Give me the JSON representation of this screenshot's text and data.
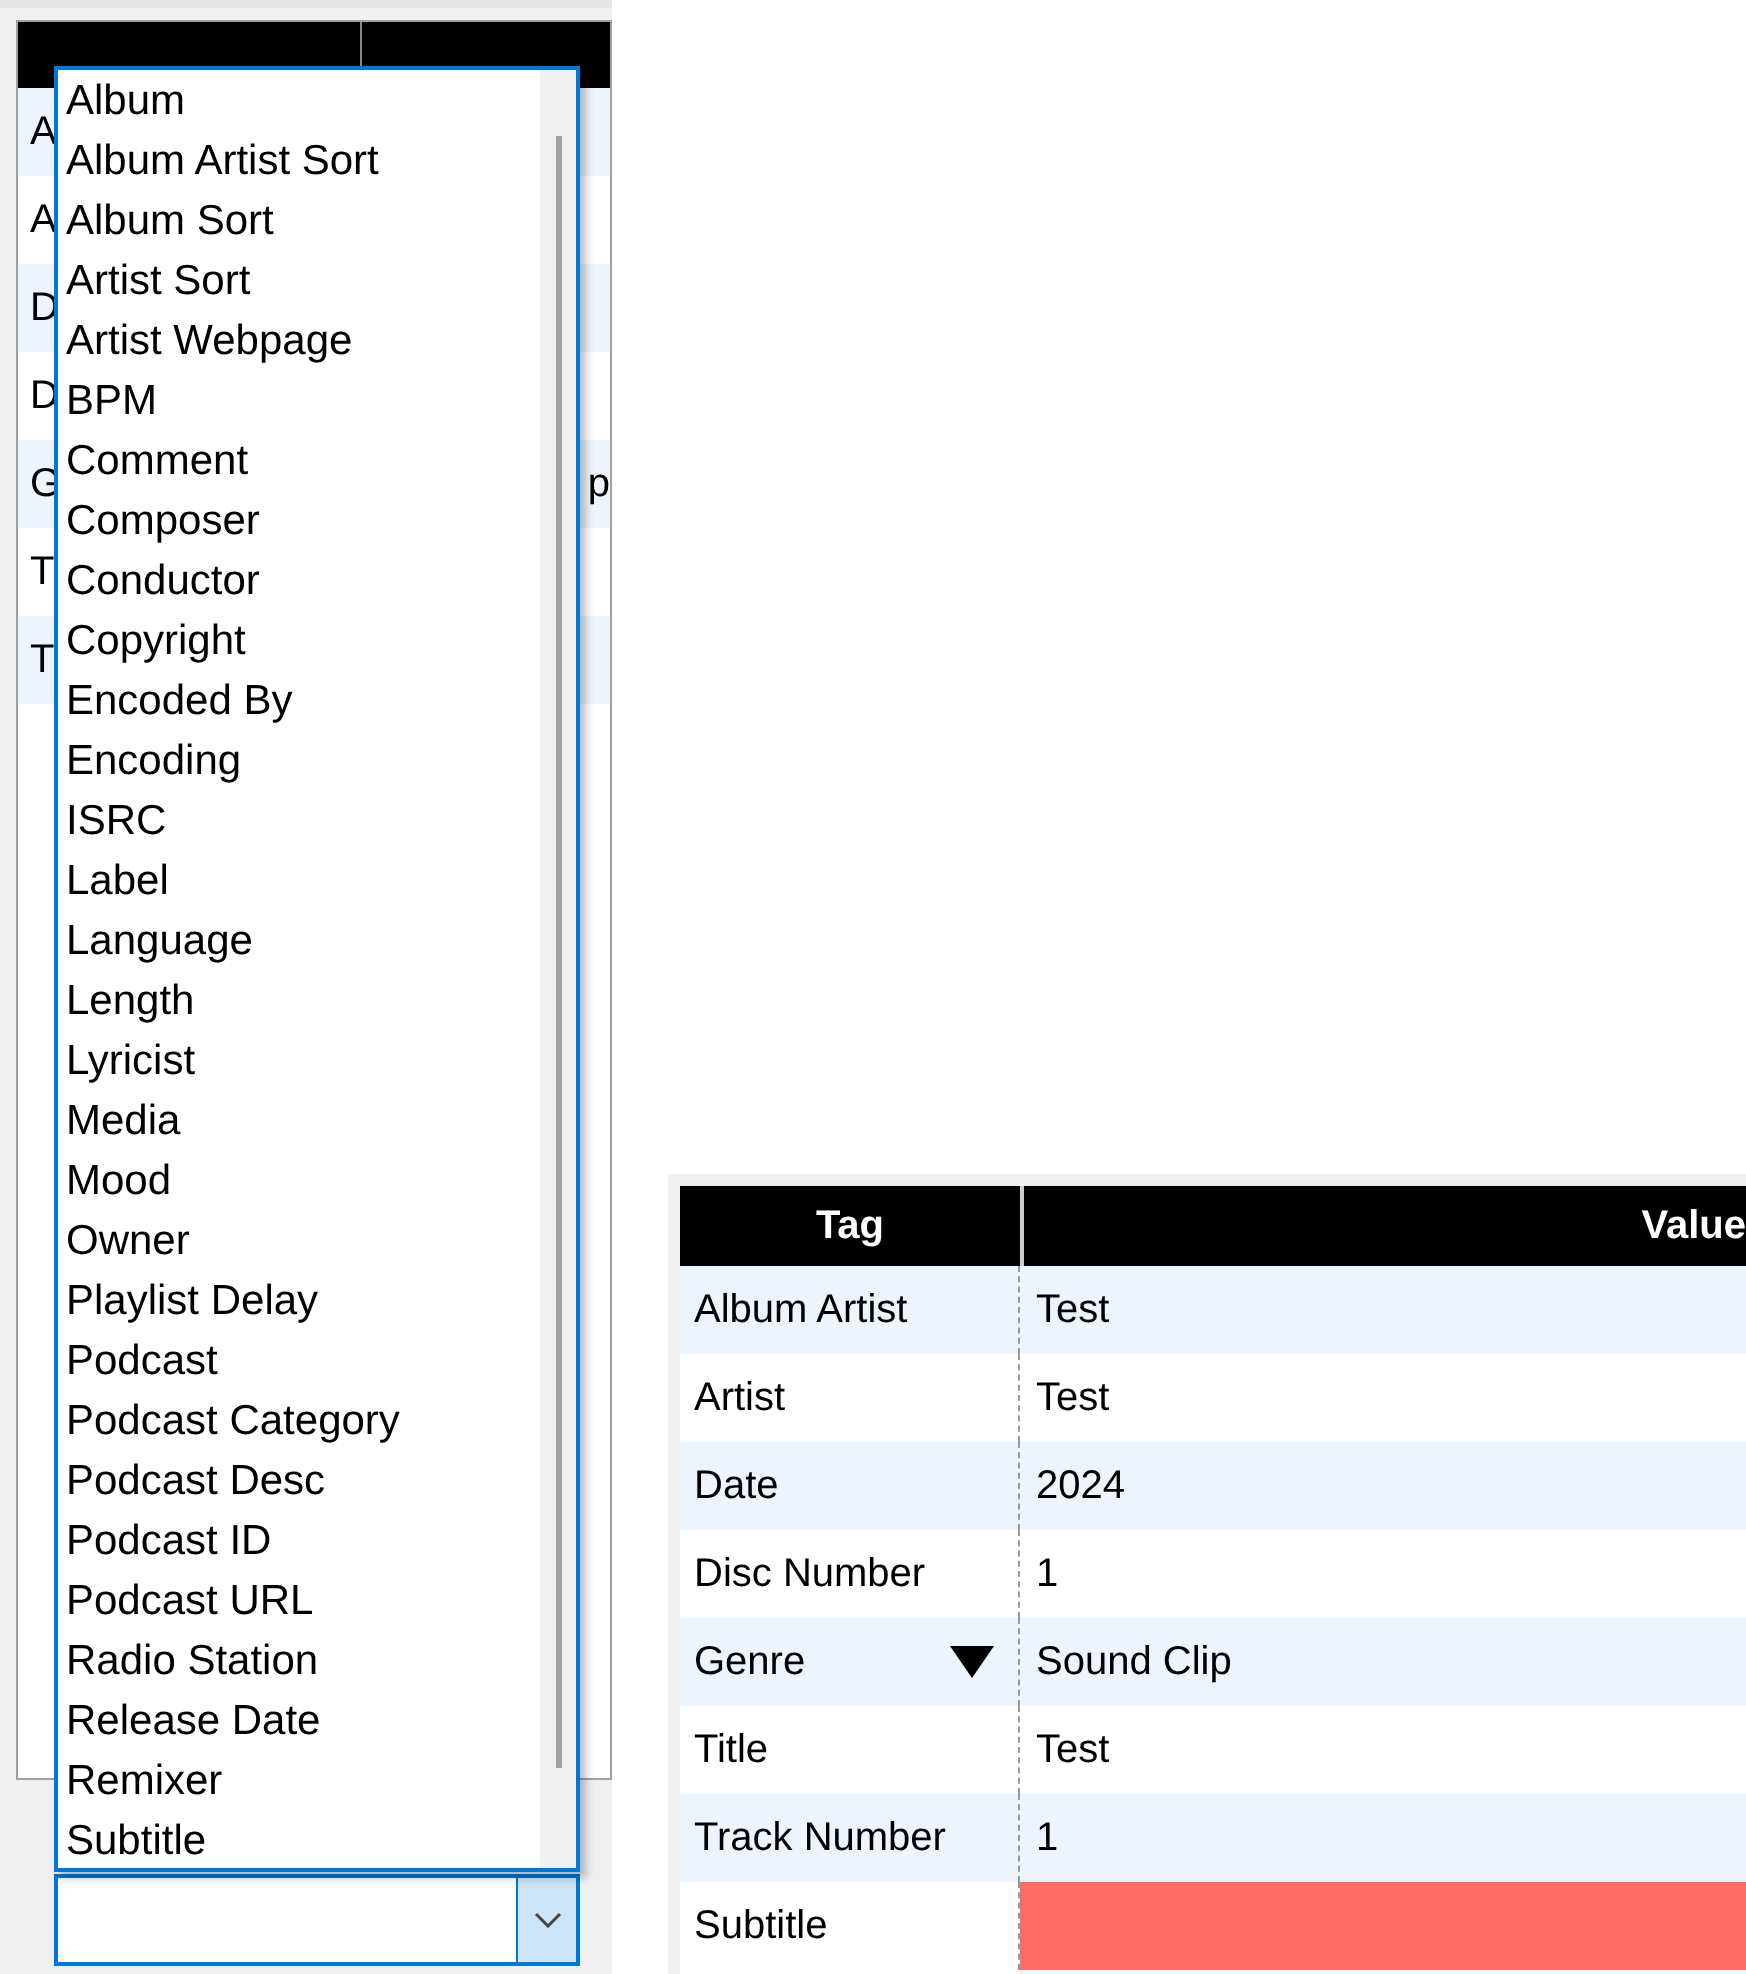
{
  "left_table": {
    "rows": [
      {
        "tag": "A"
      },
      {
        "tag": "A"
      },
      {
        "tag": "D"
      },
      {
        "tag": "D"
      },
      {
        "tag": "G",
        "value": "p"
      },
      {
        "tag": "T"
      },
      {
        "tag": "T"
      }
    ]
  },
  "dropdown": {
    "items": [
      "Album",
      "Album Artist Sort",
      "Album Sort",
      "Artist Sort",
      "Artist Webpage",
      "BPM",
      "Comment",
      "Composer",
      "Conductor",
      "Copyright",
      "Encoded By",
      "Encoding",
      "ISRC",
      "Label",
      "Language",
      "Length",
      "Lyricist",
      "Media",
      "Mood",
      "Owner",
      "Playlist Delay",
      "Podcast",
      "Podcast Category",
      "Podcast Desc",
      "Podcast ID",
      "Podcast URL",
      "Radio Station",
      "Release Date",
      "Remixer",
      "Subtitle"
    ]
  },
  "tag_table": {
    "columns": [
      "Tag",
      "Value"
    ],
    "rows": [
      {
        "tag": "Album Artist",
        "value": "Test",
        "has_dropdown": false,
        "invalid": false
      },
      {
        "tag": "Artist",
        "value": "Test",
        "has_dropdown": false,
        "invalid": false
      },
      {
        "tag": "Date",
        "value": "2024",
        "has_dropdown": false,
        "invalid": false
      },
      {
        "tag": "Disc Number",
        "value": "1",
        "has_dropdown": false,
        "invalid": false
      },
      {
        "tag": "Genre",
        "value": "Sound Clip",
        "has_dropdown": true,
        "invalid": false
      },
      {
        "tag": "Title",
        "value": "Test",
        "has_dropdown": false,
        "invalid": false
      },
      {
        "tag": "Track Number",
        "value": "1",
        "has_dropdown": false,
        "invalid": false
      },
      {
        "tag": "Subtitle",
        "has_dropdown": false,
        "invalid": true
      }
    ]
  }
}
